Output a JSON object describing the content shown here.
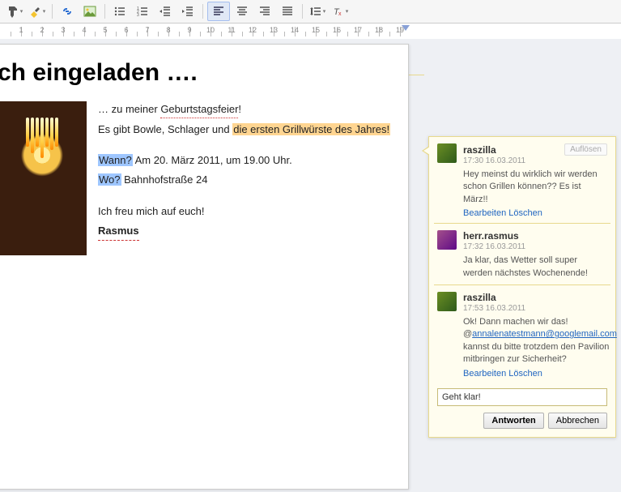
{
  "toolbar": {
    "icons": [
      "paint-icon",
      "highlight-icon",
      "link-icon",
      "image-icon",
      "bullet-list-icon",
      "numbered-list-icon",
      "outdent-icon",
      "indent-icon",
      "align-left-icon",
      "align-center-icon",
      "align-right-icon",
      "align-justify-icon",
      "line-spacing-icon",
      "clear-format-icon"
    ]
  },
  "ruler": {
    "max": 19,
    "marker_at": 496
  },
  "document": {
    "title": "ch eingeladen ….",
    "intro_prefix": "… zu meiner ",
    "intro_word": "Geburtstagsfeier",
    "intro_suffix": "!",
    "line2_prefix": "Es gibt Bowle, Schlager und ",
    "highlighted_phrase": "die ersten Grillwürste des Jahres!",
    "when_label": "Wann?",
    "when_text": " Am 20. März 2011, um 19.00 Uhr.",
    "where_label": "Wo?",
    "where_text": " Bahnhofstraße 24",
    "closing": "Ich freu mich auf euch!",
    "signature": "Rasmus"
  },
  "comments": {
    "resolve_label": "Auflösen",
    "edit_label": "Bearbeiten",
    "delete_label": "Löschen",
    "reply_value": "Geht klar!",
    "reply_button": "Antworten",
    "cancel_button": "Abbrechen",
    "thread": [
      {
        "author": "raszilla",
        "time": "17:30 16.03.2011",
        "text": "Hey meinst du wirklich wir werden schon Grillen können?? Es ist März!!",
        "avatar": "av1",
        "has_resolve": true,
        "has_actions": true
      },
      {
        "author": "herr.rasmus",
        "time": "17:32 16.03.2011",
        "text": "Ja klar, das Wetter soll super werden nächstes Wochenende!",
        "avatar": "av2",
        "has_resolve": false,
        "has_actions": false
      },
      {
        "author": "raszilla",
        "time": "17:53 16.03.2011",
        "text_before": "Ok! Dann machen wir das! @",
        "mention": "annalenatestmann@googlemail.com",
        "text_after": " kannst du bitte trotzdem den Pavilion mitbringen zur Sicherheit?",
        "avatar": "av1",
        "has_resolve": false,
        "has_actions": true
      }
    ]
  }
}
